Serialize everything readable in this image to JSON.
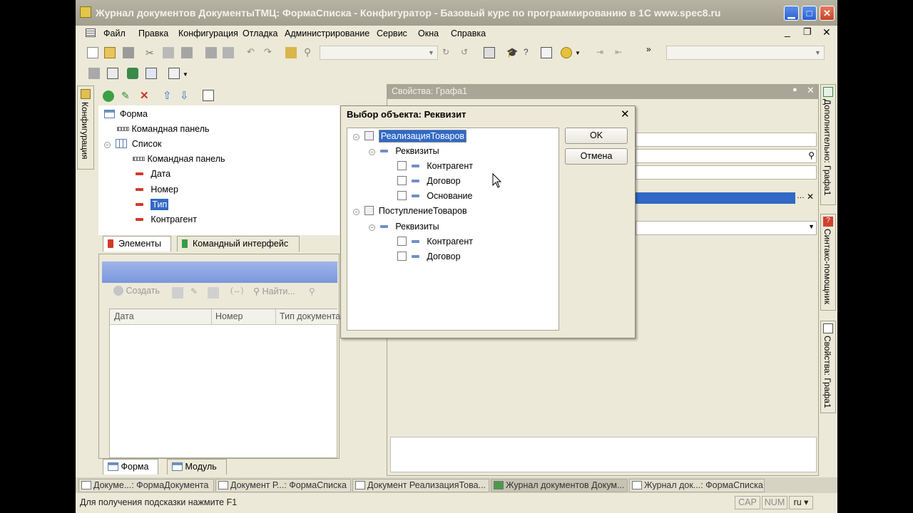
{
  "window": {
    "title": "Журнал документов ДокументыТМЦ: ФормаСписка - Конфигуратор - Базовый курс по программированию в 1С www.spec8.ru",
    "minimize": "▁",
    "maximize": "□",
    "close": "✕"
  },
  "menu": [
    "Файл",
    "Правка",
    "Конфигурация",
    "Отладка",
    "Администрирование",
    "Сервис",
    "Окна",
    "Справка"
  ],
  "mdi_controls": [
    "_",
    "❐",
    "✕"
  ],
  "left_vtab": "Конфигурация",
  "form_tree": {
    "items": [
      "Форма",
      "Командная панель",
      "Список",
      "Командная панель",
      "Дата",
      "Номер",
      "Тип",
      "Контрагент"
    ],
    "selected": "Тип",
    "tabs": [
      "Элементы",
      "Командный интерфейс"
    ]
  },
  "preview": {
    "toolbar": [
      "Создать",
      "Найти..."
    ],
    "columns": [
      "Дата",
      "Номер",
      "Тип документа"
    ]
  },
  "bottom_tabs": [
    "Форма",
    "Модуль"
  ],
  "properties": {
    "title": "Свойства: Графа1"
  },
  "dialog": {
    "title": "Выбор объекта: Реквизит",
    "close": "✕",
    "tree": [
      {
        "label": "РеализацияТоваров",
        "selected": true
      },
      {
        "label": "Реквизиты"
      },
      {
        "label": "Контрагент"
      },
      {
        "label": "Договор"
      },
      {
        "label": "Основание"
      },
      {
        "label": "ПоступлениеТоваров"
      },
      {
        "label": "Реквизиты"
      },
      {
        "label": "Контрагент"
      },
      {
        "label": "Договор"
      }
    ],
    "ok": "OK",
    "cancel": "Отмена"
  },
  "right_vtabs": [
    "Дополнительно: Графа1",
    "Синтакс-помощник",
    "Свойства: Графа1"
  ],
  "taskbar": [
    "Докуме...: ФормаДокумента",
    "Документ Р...: ФормаСписка",
    "Документ РеализацияТова...",
    "Журнал документов Докум...",
    "Журнал док...: ФормаСписка"
  ],
  "status": {
    "hint": "Для получения подсказки нажмите F1",
    "cap": "CAP",
    "num": "NUM",
    "lang": "ru ▾"
  },
  "colors": {
    "selection": "#3169c6",
    "titlebar": "#aaa698",
    "background": "#ece9d8"
  }
}
